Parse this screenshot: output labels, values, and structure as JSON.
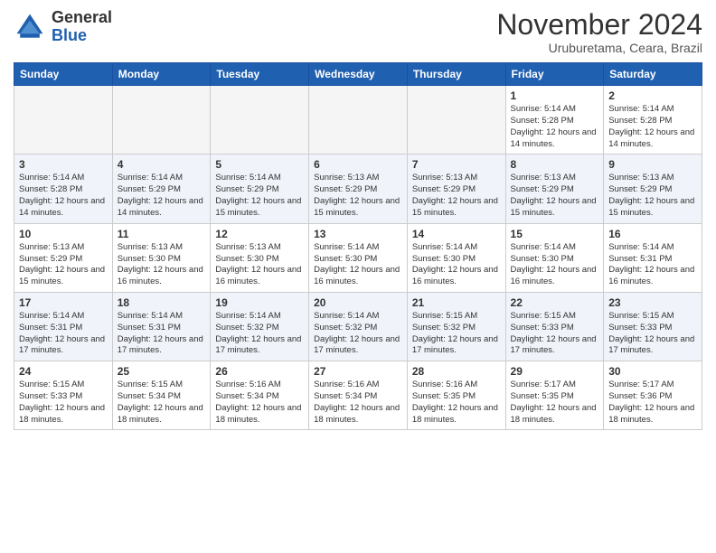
{
  "header": {
    "logo_general": "General",
    "logo_blue": "Blue",
    "month_title": "November 2024",
    "location": "Uruburetama, Ceara, Brazil"
  },
  "days_of_week": [
    "Sunday",
    "Monday",
    "Tuesday",
    "Wednesday",
    "Thursday",
    "Friday",
    "Saturday"
  ],
  "weeks": [
    [
      {
        "day": "",
        "empty": true
      },
      {
        "day": "",
        "empty": true
      },
      {
        "day": "",
        "empty": true
      },
      {
        "day": "",
        "empty": true
      },
      {
        "day": "",
        "empty": true
      },
      {
        "day": "1",
        "sunrise": "Sunrise: 5:14 AM",
        "sunset": "Sunset: 5:28 PM",
        "daylight": "Daylight: 12 hours and 14 minutes."
      },
      {
        "day": "2",
        "sunrise": "Sunrise: 5:14 AM",
        "sunset": "Sunset: 5:28 PM",
        "daylight": "Daylight: 12 hours and 14 minutes."
      }
    ],
    [
      {
        "day": "3",
        "sunrise": "Sunrise: 5:14 AM",
        "sunset": "Sunset: 5:28 PM",
        "daylight": "Daylight: 12 hours and 14 minutes."
      },
      {
        "day": "4",
        "sunrise": "Sunrise: 5:14 AM",
        "sunset": "Sunset: 5:29 PM",
        "daylight": "Daylight: 12 hours and 14 minutes."
      },
      {
        "day": "5",
        "sunrise": "Sunrise: 5:14 AM",
        "sunset": "Sunset: 5:29 PM",
        "daylight": "Daylight: 12 hours and 15 minutes."
      },
      {
        "day": "6",
        "sunrise": "Sunrise: 5:13 AM",
        "sunset": "Sunset: 5:29 PM",
        "daylight": "Daylight: 12 hours and 15 minutes."
      },
      {
        "day": "7",
        "sunrise": "Sunrise: 5:13 AM",
        "sunset": "Sunset: 5:29 PM",
        "daylight": "Daylight: 12 hours and 15 minutes."
      },
      {
        "day": "8",
        "sunrise": "Sunrise: 5:13 AM",
        "sunset": "Sunset: 5:29 PM",
        "daylight": "Daylight: 12 hours and 15 minutes."
      },
      {
        "day": "9",
        "sunrise": "Sunrise: 5:13 AM",
        "sunset": "Sunset: 5:29 PM",
        "daylight": "Daylight: 12 hours and 15 minutes."
      }
    ],
    [
      {
        "day": "10",
        "sunrise": "Sunrise: 5:13 AM",
        "sunset": "Sunset: 5:29 PM",
        "daylight": "Daylight: 12 hours and 15 minutes."
      },
      {
        "day": "11",
        "sunrise": "Sunrise: 5:13 AM",
        "sunset": "Sunset: 5:30 PM",
        "daylight": "Daylight: 12 hours and 16 minutes."
      },
      {
        "day": "12",
        "sunrise": "Sunrise: 5:13 AM",
        "sunset": "Sunset: 5:30 PM",
        "daylight": "Daylight: 12 hours and 16 minutes."
      },
      {
        "day": "13",
        "sunrise": "Sunrise: 5:14 AM",
        "sunset": "Sunset: 5:30 PM",
        "daylight": "Daylight: 12 hours and 16 minutes."
      },
      {
        "day": "14",
        "sunrise": "Sunrise: 5:14 AM",
        "sunset": "Sunset: 5:30 PM",
        "daylight": "Daylight: 12 hours and 16 minutes."
      },
      {
        "day": "15",
        "sunrise": "Sunrise: 5:14 AM",
        "sunset": "Sunset: 5:30 PM",
        "daylight": "Daylight: 12 hours and 16 minutes."
      },
      {
        "day": "16",
        "sunrise": "Sunrise: 5:14 AM",
        "sunset": "Sunset: 5:31 PM",
        "daylight": "Daylight: 12 hours and 16 minutes."
      }
    ],
    [
      {
        "day": "17",
        "sunrise": "Sunrise: 5:14 AM",
        "sunset": "Sunset: 5:31 PM",
        "daylight": "Daylight: 12 hours and 17 minutes."
      },
      {
        "day": "18",
        "sunrise": "Sunrise: 5:14 AM",
        "sunset": "Sunset: 5:31 PM",
        "daylight": "Daylight: 12 hours and 17 minutes."
      },
      {
        "day": "19",
        "sunrise": "Sunrise: 5:14 AM",
        "sunset": "Sunset: 5:32 PM",
        "daylight": "Daylight: 12 hours and 17 minutes."
      },
      {
        "day": "20",
        "sunrise": "Sunrise: 5:14 AM",
        "sunset": "Sunset: 5:32 PM",
        "daylight": "Daylight: 12 hours and 17 minutes."
      },
      {
        "day": "21",
        "sunrise": "Sunrise: 5:15 AM",
        "sunset": "Sunset: 5:32 PM",
        "daylight": "Daylight: 12 hours and 17 minutes."
      },
      {
        "day": "22",
        "sunrise": "Sunrise: 5:15 AM",
        "sunset": "Sunset: 5:33 PM",
        "daylight": "Daylight: 12 hours and 17 minutes."
      },
      {
        "day": "23",
        "sunrise": "Sunrise: 5:15 AM",
        "sunset": "Sunset: 5:33 PM",
        "daylight": "Daylight: 12 hours and 17 minutes."
      }
    ],
    [
      {
        "day": "24",
        "sunrise": "Sunrise: 5:15 AM",
        "sunset": "Sunset: 5:33 PM",
        "daylight": "Daylight: 12 hours and 18 minutes."
      },
      {
        "day": "25",
        "sunrise": "Sunrise: 5:15 AM",
        "sunset": "Sunset: 5:34 PM",
        "daylight": "Daylight: 12 hours and 18 minutes."
      },
      {
        "day": "26",
        "sunrise": "Sunrise: 5:16 AM",
        "sunset": "Sunset: 5:34 PM",
        "daylight": "Daylight: 12 hours and 18 minutes."
      },
      {
        "day": "27",
        "sunrise": "Sunrise: 5:16 AM",
        "sunset": "Sunset: 5:34 PM",
        "daylight": "Daylight: 12 hours and 18 minutes."
      },
      {
        "day": "28",
        "sunrise": "Sunrise: 5:16 AM",
        "sunset": "Sunset: 5:35 PM",
        "daylight": "Daylight: 12 hours and 18 minutes."
      },
      {
        "day": "29",
        "sunrise": "Sunrise: 5:17 AM",
        "sunset": "Sunset: 5:35 PM",
        "daylight": "Daylight: 12 hours and 18 minutes."
      },
      {
        "day": "30",
        "sunrise": "Sunrise: 5:17 AM",
        "sunset": "Sunset: 5:36 PM",
        "daylight": "Daylight: 12 hours and 18 minutes."
      }
    ]
  ]
}
